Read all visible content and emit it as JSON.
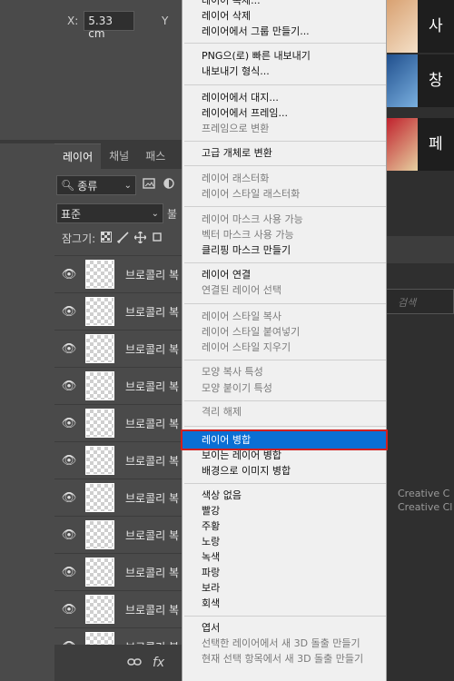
{
  "properties": {
    "x_label": "X:",
    "x_value": "5.33 cm",
    "y_label": "Y"
  },
  "tabs": [
    "레이어",
    "채널",
    "패스"
  ],
  "filter": {
    "kind": "종류"
  },
  "blend": {
    "mode": "표준",
    "opacity_trunc": "불"
  },
  "lock": {
    "label": "잠그기:"
  },
  "layers": [
    {
      "name": "브로콜리 복"
    },
    {
      "name": "브로콜리 복"
    },
    {
      "name": "브로콜리 복"
    },
    {
      "name": "브로콜리 복"
    },
    {
      "name": "브로콜리 복"
    },
    {
      "name": "브로콜리 복"
    },
    {
      "name": "브로콜리 복"
    },
    {
      "name": "브로콜리 복"
    },
    {
      "name": "브로콜리 복"
    },
    {
      "name": "브로콜리 복"
    },
    {
      "name": "브로콜리 복"
    }
  ],
  "bottom_icons": [
    "link-icon",
    "fx-icon"
  ],
  "right_panel": {
    "tiles": [
      "사",
      "창",
      "페"
    ],
    "search_placeholder": "검색",
    "cc_lines": [
      "Creative C",
      "Creative Cl"
    ]
  },
  "menu": {
    "items": [
      {
        "label": "레이어 삭제",
        "disabled": false
      },
      {
        "label": "레이어에서 그룹 만들기...",
        "disabled": false
      },
      {
        "label": "PNG으(로) 빠른 내보내기",
        "disabled": false
      },
      {
        "label": "내보내기 형식...",
        "disabled": false
      },
      {
        "label": "레이어에서 대지...",
        "disabled": false
      },
      {
        "label": "레이어에서 프레임...",
        "disabled": false
      },
      {
        "label": "프레임으로 변환",
        "disabled": true
      },
      {
        "label": "고급 개체로 변환",
        "disabled": false
      },
      {
        "label": "레이어 래스터화",
        "disabled": true
      },
      {
        "label": "레이어 스타일 래스터화",
        "disabled": true
      },
      {
        "label": "레이어 마스크 사용 가능",
        "disabled": true
      },
      {
        "label": "벡터 마스크 사용 가능",
        "disabled": true
      },
      {
        "label": "클리핑 마스크 만들기",
        "disabled": false
      },
      {
        "label": "레이어 연결",
        "disabled": false
      },
      {
        "label": "연결된 레이어 선택",
        "disabled": true
      },
      {
        "label": "레이어 스타일 복사",
        "disabled": true
      },
      {
        "label": "레이어 스타일 붙여넣기",
        "disabled": true
      },
      {
        "label": "레이어 스타일 지우기",
        "disabled": true
      },
      {
        "label": "모양 복사 특성",
        "disabled": true
      },
      {
        "label": "모양 붙이기 특성",
        "disabled": true
      },
      {
        "label": "격리 해제",
        "disabled": true
      },
      {
        "label": "레이어 병합",
        "disabled": false,
        "selected": true
      },
      {
        "label": "보이는 레이어 병합",
        "disabled": false
      },
      {
        "label": "배경으로 이미지 병합",
        "disabled": false
      },
      {
        "label": "색상 없음",
        "disabled": false
      },
      {
        "label": "빨강",
        "disabled": false
      },
      {
        "label": "주황",
        "disabled": false
      },
      {
        "label": "노랑",
        "disabled": false
      },
      {
        "label": "녹색",
        "disabled": false
      },
      {
        "label": "파랑",
        "disabled": false
      },
      {
        "label": "보라",
        "disabled": false
      },
      {
        "label": "회색",
        "disabled": false
      },
      {
        "label": "엽서",
        "disabled": false
      },
      {
        "label": "선택한 레이어에서 새 3D 돌출 만들기",
        "disabled": true
      },
      {
        "label": "현재 선택 항목에서 새 3D 돌출 만들기",
        "disabled": true
      }
    ]
  },
  "colors": {
    "selection": "#0a6fd4",
    "highlight_border": "#d11f1f"
  }
}
